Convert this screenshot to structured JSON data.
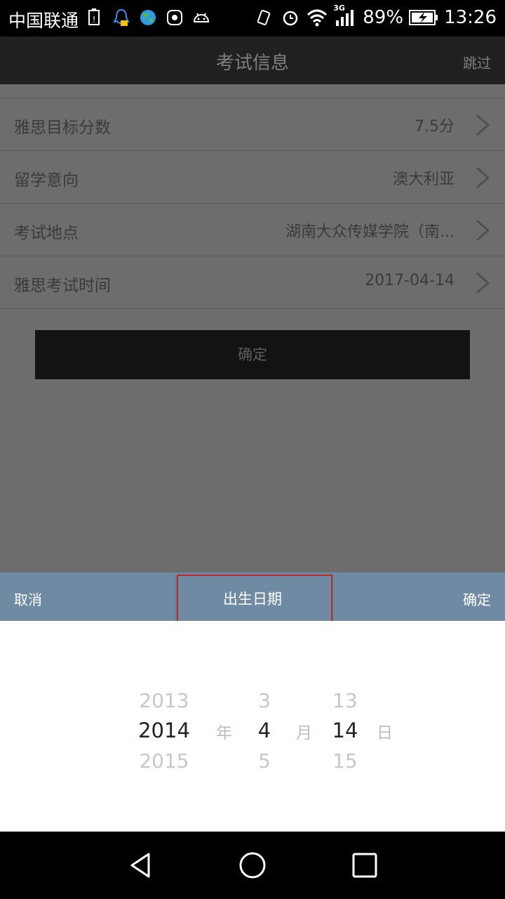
{
  "status_bar": {
    "carrier": "中国联通",
    "battery": "89%",
    "time": "13:26",
    "network": "3G",
    "icons": [
      "battery-alert-icon",
      "qq-icon",
      "earth-icon",
      "app-icon",
      "android-icon",
      "vibrate-icon",
      "alarm-icon",
      "wifi-icon",
      "signal-icon",
      "battery-charging-icon"
    ]
  },
  "header": {
    "title": "考试信息",
    "skip_label": "跳过"
  },
  "form": {
    "rows": [
      {
        "label": "雅思目标分数",
        "value": "7.5分"
      },
      {
        "label": "留学意向",
        "value": "澳大利亚"
      },
      {
        "label": "考试地点",
        "value": "湖南大众传媒学院（南..."
      },
      {
        "label": "雅思考试时间",
        "value": "2017-04-14"
      }
    ],
    "confirm_label": "确定"
  },
  "picker": {
    "cancel_label": "取消",
    "title": "出生日期",
    "ok_label": "确定",
    "year": {
      "prev": "2013",
      "selected": "2014",
      "next": "2015",
      "unit": "年"
    },
    "month": {
      "prev": "3",
      "selected": "4",
      "next": "5",
      "unit": "月"
    },
    "day": {
      "prev": "13",
      "selected": "14",
      "next": "15",
      "unit": "日"
    }
  },
  "colors": {
    "picker_bar": "#6e8ba3",
    "highlight": "#c1272d",
    "overlay": "#6d6d6d"
  }
}
